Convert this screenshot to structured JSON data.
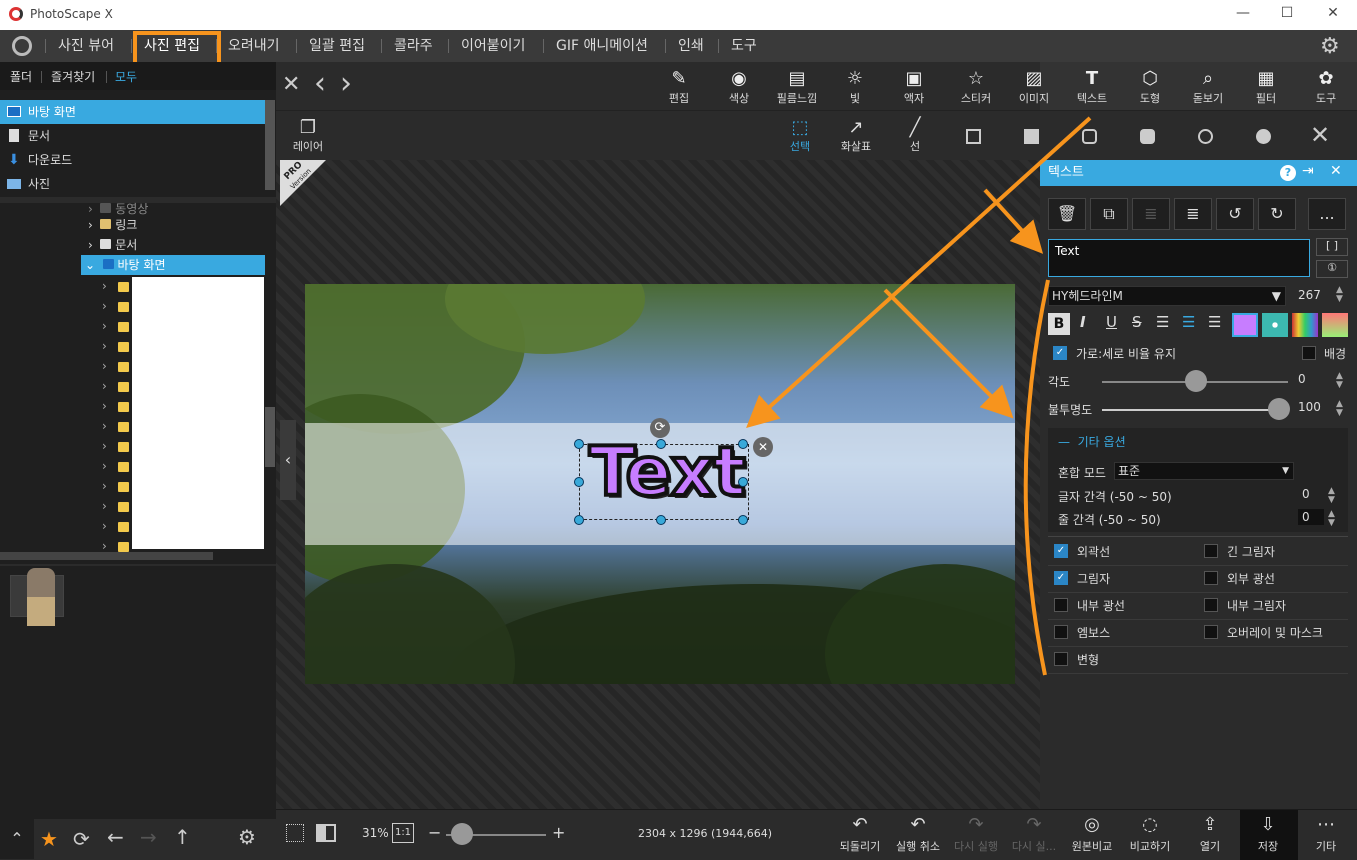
{
  "window": {
    "title": "PhotoScape X",
    "min": "—",
    "max": "☐",
    "close": "✕"
  },
  "menu": [
    "사진 뷰어",
    "사진 편집",
    "오려내기",
    "일괄 편집",
    "콜라주",
    "이어붙이기",
    "GIF 애니메이션",
    "인쇄",
    "도구"
  ],
  "left_tabs": [
    "폴더",
    "즐겨찾기",
    "모두"
  ],
  "favorites": [
    "바탕 화면",
    "문서",
    "다운로드",
    "사진"
  ],
  "tree": [
    "동영상",
    "링크",
    "문서",
    "바탕 화면"
  ],
  "nav": {
    "close": "✕",
    "prev": "‹",
    "next": "›"
  },
  "tools_main": [
    {
      "label": "편집",
      "icon": "edit-icon"
    },
    {
      "label": "색상",
      "icon": "color-icon"
    },
    {
      "label": "필름느낌",
      "icon": "film-icon"
    },
    {
      "label": "빛",
      "icon": "light-icon"
    },
    {
      "label": "액자",
      "icon": "frame-icon"
    },
    {
      "label": "스티커",
      "icon": "sticker-icon"
    },
    {
      "label": "이미지",
      "icon": "image-icon"
    },
    {
      "label": "텍스트",
      "icon": "text-icon"
    },
    {
      "label": "도형",
      "icon": "shape-icon"
    },
    {
      "label": "돋보기",
      "icon": "magnifier-icon"
    },
    {
      "label": "필터",
      "icon": "filter-icon"
    },
    {
      "label": "도구",
      "icon": "tools-icon"
    }
  ],
  "sub_tools": {
    "layer": "레이어",
    "select": "선택",
    "arrow": "화살표",
    "line": "선"
  },
  "pro_badge": {
    "top": "PRO",
    "bottom": "Version"
  },
  "canvas_text": "Text",
  "panel": {
    "title": "텍스트",
    "help": "?",
    "text_value": "Text",
    "font_name": "HY헤드라인M",
    "font_size": "267",
    "keep_ratio": "가로:세로 비율 유지",
    "background": "배경",
    "angle_label": "각도",
    "angle_value": "0",
    "opacity_label": "불투명도",
    "opacity_value": "100",
    "more_options": "기타 옵션",
    "blend_label": "혼합 모드",
    "blend_value": "표준",
    "char_spacing_label": "글자 간격 (-50 ~ 50)",
    "char_spacing_value": "0",
    "line_spacing_label": "줄 간격 (-50 ~ 50)",
    "line_spacing_value": "0",
    "more_btn": "...",
    "bracket_btn": "[ ]",
    "info_btn": "①"
  },
  "effects": [
    {
      "label": "외곽선",
      "checked": true
    },
    {
      "label": "긴 그림자",
      "checked": false
    },
    {
      "label": "그림자",
      "checked": true
    },
    {
      "label": "외부 광선",
      "checked": false
    },
    {
      "label": "내부 광선",
      "checked": false
    },
    {
      "label": "내부 그림자",
      "checked": false
    },
    {
      "label": "엠보스",
      "checked": false
    },
    {
      "label": "오버레이 및 마스크",
      "checked": false
    },
    {
      "label": "변형",
      "checked": false
    }
  ],
  "zoom": {
    "percent": "31%",
    "one_to_one": "1:1",
    "minus": "−",
    "plus": "+"
  },
  "image_info": "2304 x 1296 (1944,664)",
  "bottom_actions": [
    "되돌리기",
    "실행 취소",
    "다시 실행",
    "다시 실...",
    "원본비교",
    "비교하기",
    "열기",
    "저장",
    "기타"
  ],
  "colors": {
    "accent": "#39a9e0",
    "highlight": "#f7941d",
    "text_fill": "#c77dff"
  }
}
